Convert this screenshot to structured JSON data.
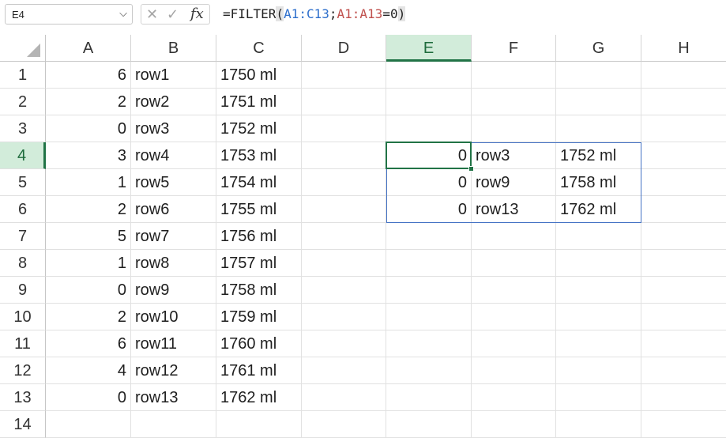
{
  "formula_bar": {
    "name_box": "E4",
    "name_box_caret": "⌵",
    "cancel_icon": "✕",
    "enter_icon": "✓",
    "fx_label": "fx",
    "formula": {
      "prefix": "=FILTER",
      "open_paren": "(",
      "range1": "A1:C13",
      "sep": ";",
      "range2": "A1:A13",
      "condition": "=0",
      "close_paren": ")"
    }
  },
  "columns": [
    "A",
    "B",
    "C",
    "D",
    "E",
    "F",
    "G",
    "H"
  ],
  "selected_column": "E",
  "selected_row": "4",
  "rows": [
    {
      "n": "1",
      "A": "6",
      "B": "row1",
      "C": "1750 ml",
      "E": "",
      "F": "",
      "G": ""
    },
    {
      "n": "2",
      "A": "2",
      "B": "row2",
      "C": "1751 ml",
      "E": "",
      "F": "",
      "G": ""
    },
    {
      "n": "3",
      "A": "0",
      "B": "row3",
      "C": "1752 ml",
      "E": "",
      "F": "",
      "G": ""
    },
    {
      "n": "4",
      "A": "3",
      "B": "row4",
      "C": "1753 ml",
      "E": "0",
      "F": "row3",
      "G": "1752 ml"
    },
    {
      "n": "5",
      "A": "1",
      "B": "row5",
      "C": "1754 ml",
      "E": "0",
      "F": "row9",
      "G": "1758 ml"
    },
    {
      "n": "6",
      "A": "2",
      "B": "row6",
      "C": "1755 ml",
      "E": "0",
      "F": "row13",
      "G": "1762 ml"
    },
    {
      "n": "7",
      "A": "5",
      "B": "row7",
      "C": "1756 ml",
      "E": "",
      "F": "",
      "G": ""
    },
    {
      "n": "8",
      "A": "1",
      "B": "row8",
      "C": "1757 ml",
      "E": "",
      "F": "",
      "G": ""
    },
    {
      "n": "9",
      "A": "0",
      "B": "row9",
      "C": "1758 ml",
      "E": "",
      "F": "",
      "G": ""
    },
    {
      "n": "10",
      "A": "2",
      "B": "row10",
      "C": "1759 ml",
      "E": "",
      "F": "",
      "G": ""
    },
    {
      "n": "11",
      "A": "6",
      "B": "row11",
      "C": "1760 ml",
      "E": "",
      "F": "",
      "G": ""
    },
    {
      "n": "12",
      "A": "4",
      "B": "row12",
      "C": "1761 ml",
      "E": "",
      "F": "",
      "G": ""
    },
    {
      "n": "13",
      "A": "0",
      "B": "row13",
      "C": "1762 ml",
      "E": "",
      "F": "",
      "G": ""
    },
    {
      "n": "14",
      "A": "",
      "B": "",
      "C": "",
      "E": "",
      "F": "",
      "G": ""
    }
  ],
  "colors": {
    "selection_green": "#217346",
    "header_highlight": "#d2ecda",
    "spill_border": "#4472c4",
    "range_ref_blue": "#2e6fcc",
    "range_ref_red": "#c0504d"
  }
}
